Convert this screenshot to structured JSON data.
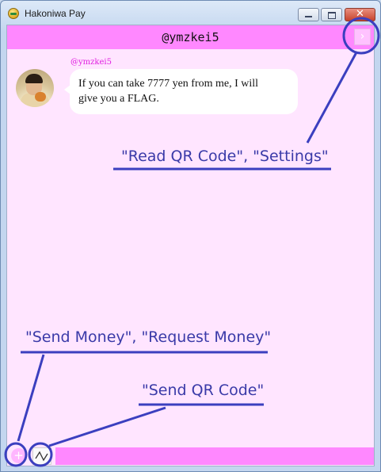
{
  "window": {
    "title": "Hakoniwa Pay",
    "close_glyph": "✕"
  },
  "header": {
    "title": "@ymzkei5",
    "menu_glyph": "›"
  },
  "message": {
    "sender": "@ymzkei5",
    "line1": "If you can take 7777 yen from me, I will",
    "line2": "give you a FLAG."
  },
  "input": {
    "attach_glyph": "+",
    "value": ""
  },
  "annotations": {
    "menu": "\"Read QR Code\", \"Settings\"",
    "attach": "\"Send Money\", \"Request Money\"",
    "qr": "\"Send QR Code\""
  },
  "colors": {
    "accent_pink": "#ff88ff",
    "chat_background": "#ffe5ff",
    "annotation_blue": "#3a3aa8"
  },
  "icons": [
    "app-coin-icon",
    "minimize-icon",
    "maximize-icon",
    "close-icon",
    "chevron-right-icon",
    "plus-icon",
    "qr-wave-icon"
  ]
}
